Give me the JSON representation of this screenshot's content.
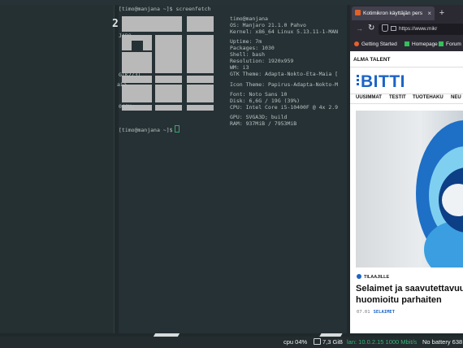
{
  "workspace_number": "2",
  "terminal": {
    "prompt_line": "[timo@manjana ~]$ screenfetch",
    "final_prompt": "[timo@manjana ~]$",
    "user_host": "timo@manjana",
    "info": [
      "OS: Manjaro 21.1.0 Pahvo",
      "Kernel: x86_64 Linux 5.13.11-1-MAN",
      "Uptime: 7m",
      "Packages: 1030",
      "Shell: bash",
      "Resolution: 1920x959",
      "WM: i3",
      "GTK Theme: Adapta-Nokto-Eta-Maia [",
      "Icon Theme: Papirus-Adapta-Nokto-M",
      "Font: Noto Sans 10",
      "Disk: 6,6G / 19G (39%)",
      "CPU: Intel Core i5-10400F @ 4x 2.9",
      "GPU: SVGA3D; build",
      "RAM: 937MiB / 7953MiB"
    ],
    "left_fragments": [
      "JARO",
      "GTK2/3]",
      "aia",
      "04GHz"
    ]
  },
  "browser": {
    "tab_title": "Kotimikron käyttäjän pers",
    "tab_close": "×",
    "new_tab": "+",
    "url": "https://www.mikr",
    "bookmarks": [
      "Getting Started",
      "Homepage",
      "Forum"
    ]
  },
  "site": {
    "top_label": "ALMA TALENT",
    "logo": "BITTI",
    "nav": [
      "UUSIMMAT",
      "TESTIT",
      "TUOTEHAKU",
      "NEU"
    ],
    "tag": "TILAAJILLE",
    "headline": [
      "Selaimet ja saavutettavuus:",
      "huomioitu parhaiten"
    ],
    "date": "07.01",
    "category": "SELAIMET"
  },
  "statusbar": {
    "cpu": "cpu  04%",
    "disk": "7,3 GiB",
    "lan": "lan: 10.0.2.15 1000 Mbit/s",
    "battery": "No battery  638"
  },
  "colors": {
    "terminal_bg": "#263135",
    "browser_chrome": "#2b2a33",
    "accent_blue": "#1c64c6",
    "net_green": "#34b678"
  }
}
